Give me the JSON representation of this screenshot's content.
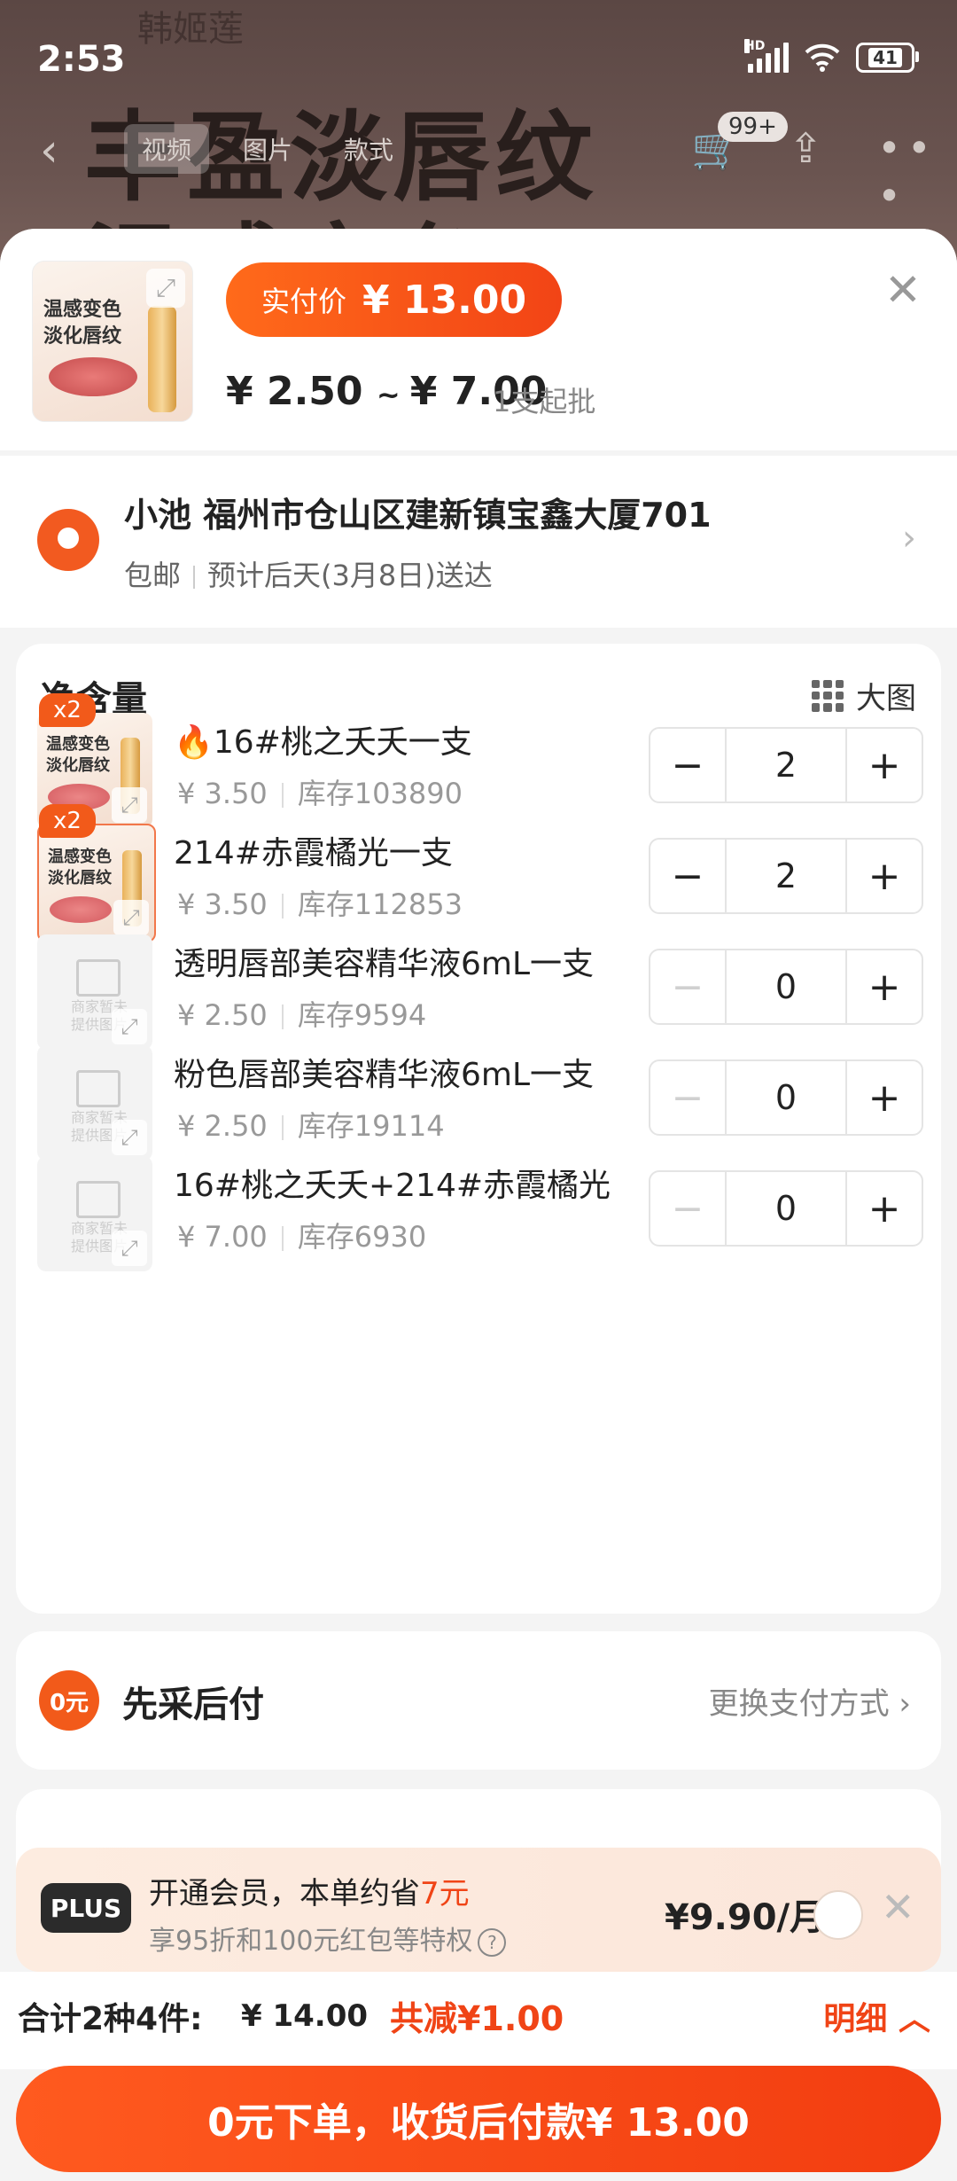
{
  "status_bar": {
    "time": "2:53",
    "network": "HD",
    "battery": "41"
  },
  "background_page": {
    "shop_name": "韩姬莲",
    "headline_1": "丰盈淡唇纹",
    "headline_2": "温感变色",
    "tabs": [
      "视频",
      "图片",
      "款式"
    ],
    "cart_badge": "99+"
  },
  "header": {
    "product_thumb_text": "温感变色\n淡化唇纹",
    "actual_price_label": "实付价",
    "actual_price": "¥ 13.00",
    "price_range_low": "2.50",
    "price_range_high": "7.00",
    "currency": "¥",
    "min_order": "1支起批"
  },
  "address": {
    "line": "小池 福州市仓山区建新镇宝鑫大厦701",
    "shipping": "包邮",
    "delivery": "预计后天(3月8日)送达"
  },
  "spec": {
    "title": "净含量",
    "big_image_label": "大图",
    "items": [
      {
        "badge": "x2",
        "name": "🔥16#桃之夭夭一支",
        "price": "¥ 3.50",
        "stock": "库存103890",
        "qty": "2",
        "thumb_text": "温感变色\n淡化唇纹"
      },
      {
        "badge": "x2",
        "name": "214#赤霞橘光一支",
        "price": "¥ 3.50",
        "stock": "库存112853",
        "qty": "2",
        "thumb_text": "温感变色\n淡化唇纹"
      },
      {
        "name": "透明唇部美容精华液6mL一支",
        "price": "¥ 2.50",
        "stock": "库存9594",
        "qty": "0",
        "placeholder": "商家暂未\n提供图片"
      },
      {
        "name": "粉色唇部美容精华液6mL一支",
        "price": "¥ 2.50",
        "stock": "库存19114",
        "qty": "0",
        "placeholder": "商家暂未\n提供图片"
      },
      {
        "name": "16#桃之夭夭+214#赤霞橘光",
        "price": "¥ 7.00",
        "stock": "库存6930",
        "qty": "0",
        "placeholder": "商家暂未\n提供图片"
      }
    ]
  },
  "payment": {
    "icon_text": "0元",
    "title": "先采后付",
    "change": "更换支付方式"
  },
  "plus": {
    "badge": "PLUS",
    "main_prefix": "开通会员，本单约省",
    "main_amount": "7元",
    "sub": "享95折和100元红包等特权",
    "price": "¥9.90/月"
  },
  "total": {
    "summary": "合计2种4件:",
    "amount": "¥ 14.00",
    "discount": "共减¥1.00",
    "detail": "明细"
  },
  "cta": {
    "label": "0元下单，收货后付款¥ 13.00"
  },
  "colors": {
    "accent": "#f25a1a",
    "accent_dark": "#f04416"
  }
}
